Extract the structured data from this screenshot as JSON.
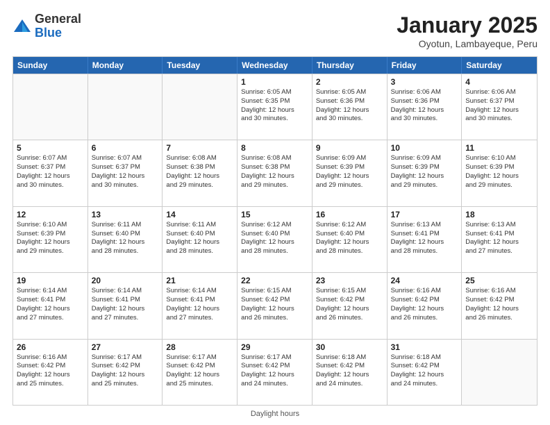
{
  "header": {
    "logo_general": "General",
    "logo_blue": "Blue",
    "month_title": "January 2025",
    "subtitle": "Oyotun, Lambayeque, Peru"
  },
  "days_of_week": [
    "Sunday",
    "Monday",
    "Tuesday",
    "Wednesday",
    "Thursday",
    "Friday",
    "Saturday"
  ],
  "footer": {
    "label": "Daylight hours"
  },
  "weeks": [
    [
      {
        "day": "",
        "info": ""
      },
      {
        "day": "",
        "info": ""
      },
      {
        "day": "",
        "info": ""
      },
      {
        "day": "1",
        "info": "Sunrise: 6:05 AM\nSunset: 6:35 PM\nDaylight: 12 hours\nand 30 minutes."
      },
      {
        "day": "2",
        "info": "Sunrise: 6:05 AM\nSunset: 6:36 PM\nDaylight: 12 hours\nand 30 minutes."
      },
      {
        "day": "3",
        "info": "Sunrise: 6:06 AM\nSunset: 6:36 PM\nDaylight: 12 hours\nand 30 minutes."
      },
      {
        "day": "4",
        "info": "Sunrise: 6:06 AM\nSunset: 6:37 PM\nDaylight: 12 hours\nand 30 minutes."
      }
    ],
    [
      {
        "day": "5",
        "info": "Sunrise: 6:07 AM\nSunset: 6:37 PM\nDaylight: 12 hours\nand 30 minutes."
      },
      {
        "day": "6",
        "info": "Sunrise: 6:07 AM\nSunset: 6:37 PM\nDaylight: 12 hours\nand 30 minutes."
      },
      {
        "day": "7",
        "info": "Sunrise: 6:08 AM\nSunset: 6:38 PM\nDaylight: 12 hours\nand 29 minutes."
      },
      {
        "day": "8",
        "info": "Sunrise: 6:08 AM\nSunset: 6:38 PM\nDaylight: 12 hours\nand 29 minutes."
      },
      {
        "day": "9",
        "info": "Sunrise: 6:09 AM\nSunset: 6:39 PM\nDaylight: 12 hours\nand 29 minutes."
      },
      {
        "day": "10",
        "info": "Sunrise: 6:09 AM\nSunset: 6:39 PM\nDaylight: 12 hours\nand 29 minutes."
      },
      {
        "day": "11",
        "info": "Sunrise: 6:10 AM\nSunset: 6:39 PM\nDaylight: 12 hours\nand 29 minutes."
      }
    ],
    [
      {
        "day": "12",
        "info": "Sunrise: 6:10 AM\nSunset: 6:39 PM\nDaylight: 12 hours\nand 29 minutes."
      },
      {
        "day": "13",
        "info": "Sunrise: 6:11 AM\nSunset: 6:40 PM\nDaylight: 12 hours\nand 28 minutes."
      },
      {
        "day": "14",
        "info": "Sunrise: 6:11 AM\nSunset: 6:40 PM\nDaylight: 12 hours\nand 28 minutes."
      },
      {
        "day": "15",
        "info": "Sunrise: 6:12 AM\nSunset: 6:40 PM\nDaylight: 12 hours\nand 28 minutes."
      },
      {
        "day": "16",
        "info": "Sunrise: 6:12 AM\nSunset: 6:40 PM\nDaylight: 12 hours\nand 28 minutes."
      },
      {
        "day": "17",
        "info": "Sunrise: 6:13 AM\nSunset: 6:41 PM\nDaylight: 12 hours\nand 28 minutes."
      },
      {
        "day": "18",
        "info": "Sunrise: 6:13 AM\nSunset: 6:41 PM\nDaylight: 12 hours\nand 27 minutes."
      }
    ],
    [
      {
        "day": "19",
        "info": "Sunrise: 6:14 AM\nSunset: 6:41 PM\nDaylight: 12 hours\nand 27 minutes."
      },
      {
        "day": "20",
        "info": "Sunrise: 6:14 AM\nSunset: 6:41 PM\nDaylight: 12 hours\nand 27 minutes."
      },
      {
        "day": "21",
        "info": "Sunrise: 6:14 AM\nSunset: 6:41 PM\nDaylight: 12 hours\nand 27 minutes."
      },
      {
        "day": "22",
        "info": "Sunrise: 6:15 AM\nSunset: 6:42 PM\nDaylight: 12 hours\nand 26 minutes."
      },
      {
        "day": "23",
        "info": "Sunrise: 6:15 AM\nSunset: 6:42 PM\nDaylight: 12 hours\nand 26 minutes."
      },
      {
        "day": "24",
        "info": "Sunrise: 6:16 AM\nSunset: 6:42 PM\nDaylight: 12 hours\nand 26 minutes."
      },
      {
        "day": "25",
        "info": "Sunrise: 6:16 AM\nSunset: 6:42 PM\nDaylight: 12 hours\nand 26 minutes."
      }
    ],
    [
      {
        "day": "26",
        "info": "Sunrise: 6:16 AM\nSunset: 6:42 PM\nDaylight: 12 hours\nand 25 minutes."
      },
      {
        "day": "27",
        "info": "Sunrise: 6:17 AM\nSunset: 6:42 PM\nDaylight: 12 hours\nand 25 minutes."
      },
      {
        "day": "28",
        "info": "Sunrise: 6:17 AM\nSunset: 6:42 PM\nDaylight: 12 hours\nand 25 minutes."
      },
      {
        "day": "29",
        "info": "Sunrise: 6:17 AM\nSunset: 6:42 PM\nDaylight: 12 hours\nand 24 minutes."
      },
      {
        "day": "30",
        "info": "Sunrise: 6:18 AM\nSunset: 6:42 PM\nDaylight: 12 hours\nand 24 minutes."
      },
      {
        "day": "31",
        "info": "Sunrise: 6:18 AM\nSunset: 6:42 PM\nDaylight: 12 hours\nand 24 minutes."
      },
      {
        "day": "",
        "info": ""
      }
    ]
  ]
}
